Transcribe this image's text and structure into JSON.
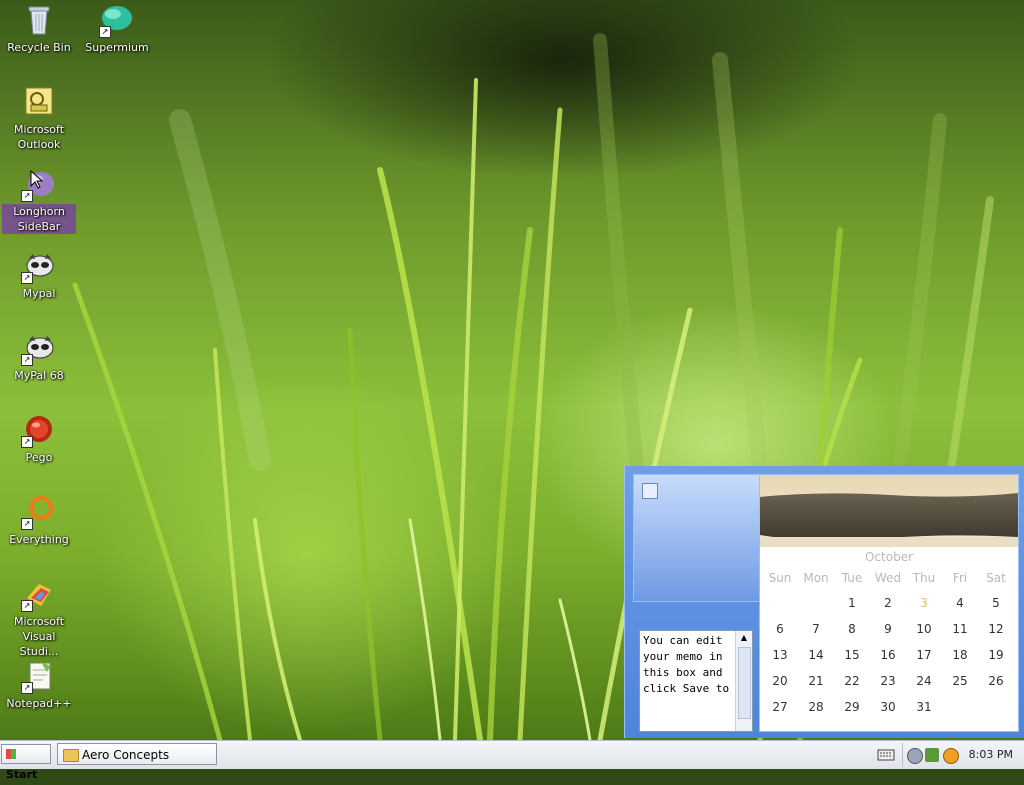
{
  "desktop": {
    "icons": [
      {
        "label": "Recycle Bin",
        "icon": "recycle-bin-icon"
      },
      {
        "label": "Supermium",
        "icon": "supermium-icon"
      },
      {
        "label": "Microsoft Outlook",
        "icon": "outlook-icon"
      },
      {
        "label": "Longhorn SideBar",
        "icon": "sidebar-icon",
        "selected": true
      },
      {
        "label": "Mypal",
        "icon": "mypal-icon"
      },
      {
        "label": "MyPal 68",
        "icon": "mypal68-icon"
      },
      {
        "label": "Pego",
        "icon": "pego-icon"
      },
      {
        "label": "Everything",
        "icon": "everything-icon"
      },
      {
        "label": "Microsoft Visual Studi...",
        "icon": "visual-studio-icon"
      },
      {
        "label": "Notepad++",
        "icon": "notepadpp-icon"
      }
    ]
  },
  "sidebar": {
    "memo": {
      "text": "You can edit your memo in this box and click Save to"
    },
    "calendar": {
      "month": "October",
      "weekdays": [
        "Sun",
        "Mon",
        "Tue",
        "Wed",
        "Thu",
        "Fri",
        "Sat"
      ],
      "today": "3",
      "weeks": [
        [
          "",
          "",
          "1",
          "2",
          "3",
          "4",
          "5"
        ],
        [
          "6",
          "7",
          "8",
          "9",
          "10",
          "11",
          "12"
        ],
        [
          "13",
          "14",
          "15",
          "16",
          "17",
          "18",
          "19"
        ],
        [
          "20",
          "21",
          "22",
          "23",
          "24",
          "25",
          "26"
        ],
        [
          "27",
          "28",
          "29",
          "30",
          "31",
          "",
          ""
        ]
      ]
    }
  },
  "taskbar": {
    "start_label": "Start",
    "windows": [
      {
        "label": "Aero Concepts",
        "icon": "folder-icon"
      }
    ],
    "clock": "8:03 PM"
  },
  "colors": {
    "sidebar_bg": "#5a8ce0",
    "taskbar_bg": "#e6e9ee",
    "today": "#d7c550"
  }
}
